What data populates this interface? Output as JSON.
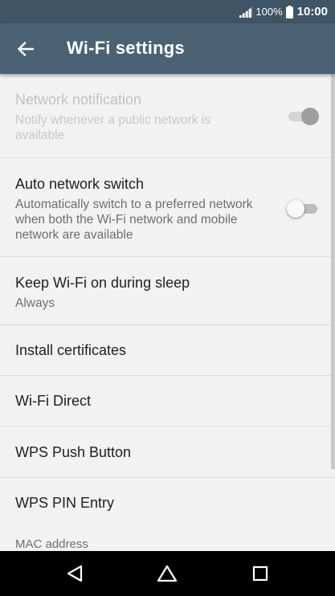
{
  "status_bar": {
    "battery_percent": "100%",
    "time": "10:00",
    "icons": [
      "signal-icon",
      "battery-icon"
    ]
  },
  "app_bar": {
    "title": "Wi-Fi settings",
    "back_icon": "back-arrow-icon"
  },
  "settings": {
    "network_notification": {
      "title": "Network notification",
      "summary": "Notify whenever a public network is available",
      "enabled": false,
      "toggle_on": true
    },
    "auto_network_switch": {
      "title": "Auto network switch",
      "summary": "Automatically switch to a preferred network when both the Wi-Fi network and mobile network are available",
      "toggle_on": false
    },
    "keep_wifi_on": {
      "title": "Keep Wi-Fi on during sleep",
      "summary": "Always"
    },
    "install_certificates": {
      "title": "Install certificates"
    },
    "wifi_direct": {
      "title": "Wi-Fi Direct"
    },
    "wps_push_button": {
      "title": "WPS Push Button"
    },
    "wps_pin_entry": {
      "title": "WPS PIN Entry"
    },
    "mac_address": {
      "label": "MAC address"
    }
  },
  "nav_bar": {
    "icons": [
      "back-triangle-icon",
      "home-icon",
      "recents-icon"
    ]
  },
  "colors": {
    "status_bar": "#3f5465",
    "app_bar": "#4a6274",
    "background": "#f2f2f2",
    "divider": "#dcdcdc",
    "nav_bar": "#000000"
  }
}
